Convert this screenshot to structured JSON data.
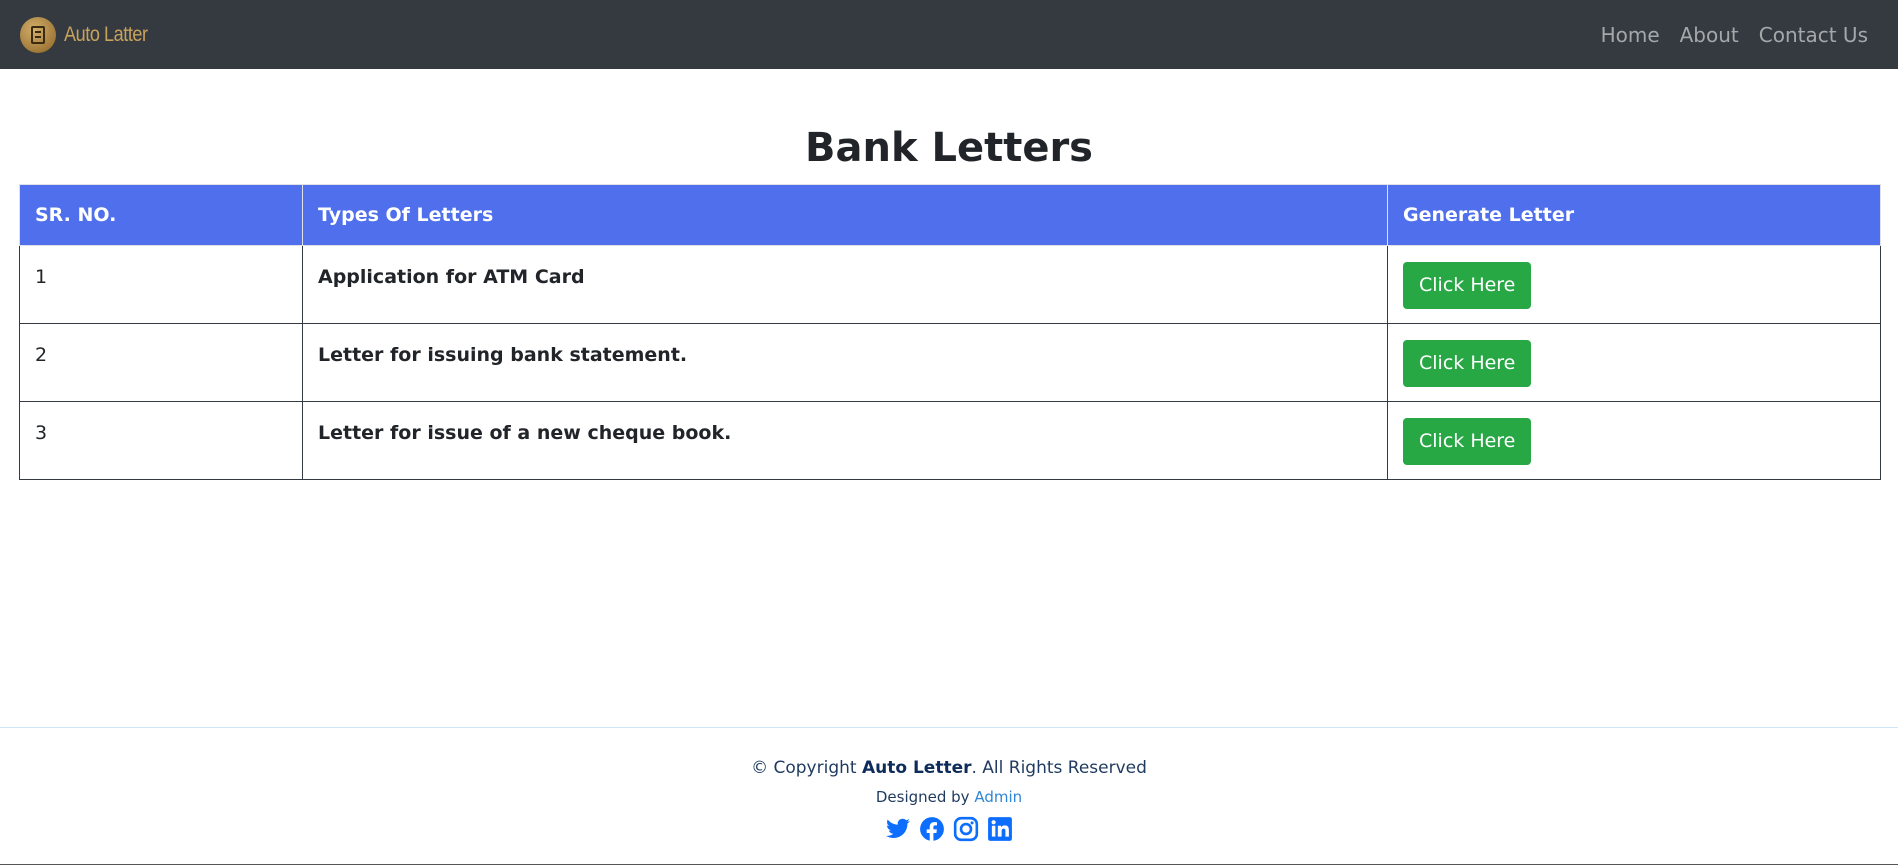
{
  "navbar": {
    "brand": "Auto Latter",
    "links": [
      "Home",
      "About",
      "Contact Us"
    ]
  },
  "main": {
    "title": "Bank Letters",
    "table": {
      "headers": [
        "SR. NO.",
        "Types Of Letters",
        "Generate Letter"
      ],
      "rows": [
        {
          "sr": "1",
          "type": "Application for ATM Card",
          "action": "Click Here"
        },
        {
          "sr": "2",
          "type": "Letter for issuing bank statement.",
          "action": "Click Here"
        },
        {
          "sr": "3",
          "type": "Letter for issue of a new cheque book.",
          "action": "Click Here"
        }
      ]
    }
  },
  "footer": {
    "copyright_prefix": "© Copyright",
    "copyright_brand": "Auto Letter",
    "copyright_suffix": ". All Rights Reserved",
    "designed_prefix": "Designed by",
    "designed_link": "Admin",
    "socials": [
      "twitter-icon",
      "facebook-icon",
      "instagram-icon",
      "linkedin-icon"
    ]
  },
  "colors": {
    "navbar_bg": "#343a40",
    "table_header_bg": "#4f6fec",
    "button_bg": "#28a745",
    "social_icon": "#0d6efd"
  }
}
